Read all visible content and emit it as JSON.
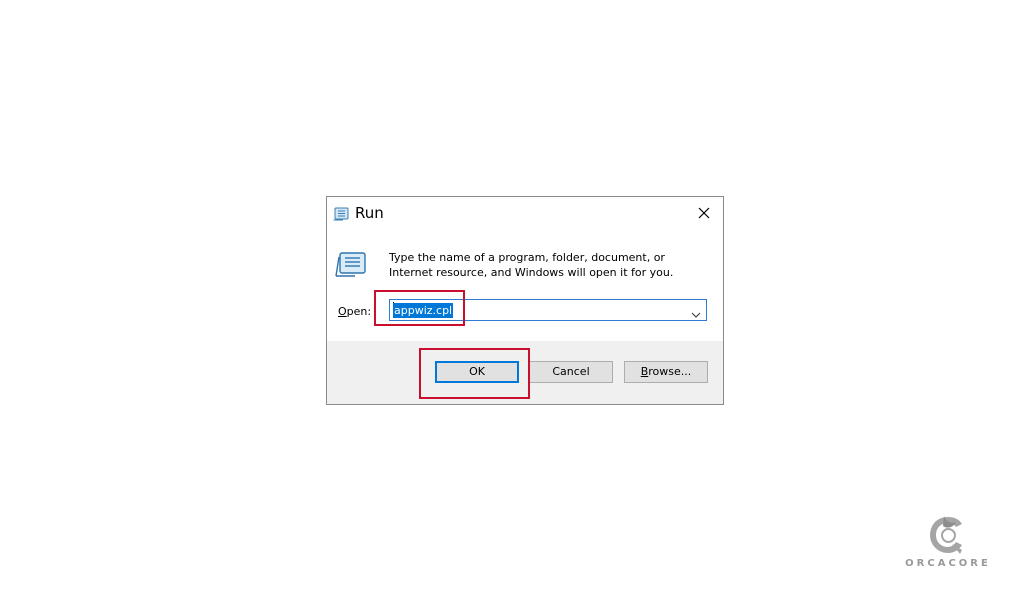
{
  "dialog": {
    "title": "Run",
    "title_icon": "run-icon",
    "close_icon": "close-icon",
    "description": "Type the name of a program, folder, document, or Internet resource, and Windows will open it for you.",
    "open_label_mnemonic": "O",
    "open_label_rest": "pen:",
    "input_value": "appwiz.cpl",
    "dropdown_icon": "chevron-down-icon",
    "buttons": {
      "ok": "OK",
      "cancel": "Cancel",
      "browse_mnemonic": "B",
      "browse_rest": "rowse..."
    }
  },
  "watermark": {
    "text": "ORCACORE"
  },
  "colors": {
    "highlight": "#c8102e",
    "focus": "#0078d7",
    "footer_bg": "#f0f0f0",
    "button_bg": "#e1e1e1"
  }
}
